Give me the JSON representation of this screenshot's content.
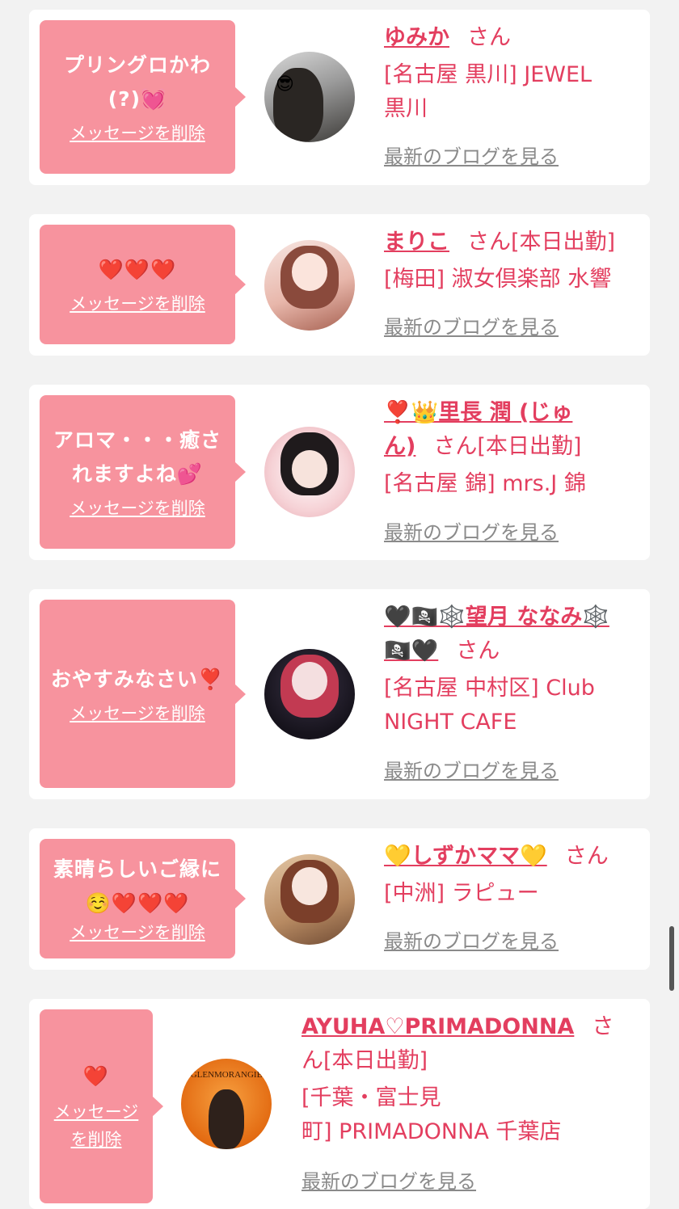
{
  "colors": {
    "accent": "#e33e5f",
    "bubble": "#f7939e",
    "link_gray": "#8a8a8a",
    "background": "#f2f2f2"
  },
  "delete_label": "メッセージを削除",
  "delete_label_l1": "メッセージ",
  "delete_label_l2": "を削除",
  "blog_label": "最新のブログを見る",
  "san": "さん",
  "items": [
    {
      "message_l1": "プリングロかわ",
      "message_l2": "(?)💓",
      "name": "ゆみか",
      "status": "",
      "shop_l1": "[名古屋 黒川] JEWEL",
      "shop_l2": "黒川"
    },
    {
      "message_l1": "❤️❤️❤️",
      "name": "まりこ",
      "status": "[本日出勤]",
      "shop_l1": "[梅田] 淑女倶楽部 水響"
    },
    {
      "message_l1": "アロマ・・・癒さ",
      "message_l2": "れますよね💕",
      "name_l1": "❣️👑里長 潤 (じゅ",
      "name_l2": "ん)",
      "status": "[本日出勤]",
      "shop_l1": "[名古屋 錦] mrs.J 錦"
    },
    {
      "message_l1": "おやすみなさい❣️",
      "name_l1": "🖤🏴‍☠️🕸️望月 ななみ🕸️",
      "name_l2": "🏴‍☠️🖤",
      "status": "",
      "shop_l1": "[名古屋 中村区] Club",
      "shop_l2": "NIGHT CAFE"
    },
    {
      "message_l1": "素晴らしいご縁に",
      "message_l2": "☺️❤️❤️❤️",
      "name": "💛しずかママ💛",
      "status": "",
      "shop_l1": "[中洲] ラピュー"
    },
    {
      "message_l1": "❤️",
      "name": "AYUHA♡PRIMADONNA",
      "san_l1": "さ",
      "san_l2": "ん",
      "status": "[本日出勤]",
      "shop_l1": "[千葉・富士見",
      "shop_l2": "町] PRIMADONNA 千葉店",
      "avatar_text": "GLENMORANGIE"
    }
  ]
}
